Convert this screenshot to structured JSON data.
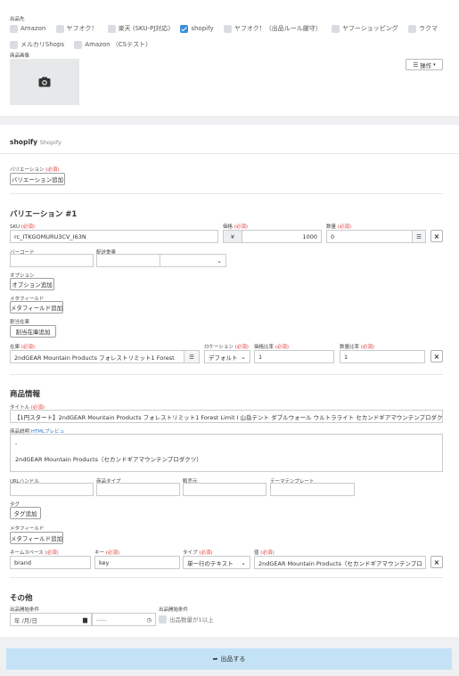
{
  "stores": {
    "label": "出品先",
    "items": [
      {
        "label": "Amazon",
        "checked": false
      },
      {
        "label": "ヤフオク！",
        "checked": false
      },
      {
        "label": "楽天 (SKU-PJ対応)",
        "checked": false
      },
      {
        "label": "shopify",
        "checked": true
      },
      {
        "label": "ヤフオク！（出品ルール厳守）",
        "checked": false
      },
      {
        "label": "ヤフーショッピング",
        "checked": false
      },
      {
        "label": "ラクマ",
        "checked": false
      },
      {
        "label": "メルカリShops",
        "checked": false
      },
      {
        "label": "Amazon （CSテスト）",
        "checked": false
      }
    ]
  },
  "product_image": {
    "label": "商品画像",
    "operations_label": "操作"
  },
  "shopify_header": {
    "title": "shopify",
    "subtitle": "Shopify"
  },
  "variation": {
    "label": "バリエーション",
    "required": "(必須)",
    "add_button": "バリエーション追加",
    "heading": "バリエーション #1",
    "sku_label": "SKU",
    "sku_value": "rc_ITKGOMURU3CV_I63N",
    "price_label": "価格",
    "price_prefix": "¥",
    "price_value": "1000",
    "stock_label": "数量",
    "stock_value": "0",
    "barcode_label": "バーコード",
    "weight_label": "配送重量",
    "option_label": "オプション",
    "option_add": "オプション追加",
    "metafield_label": "メタフィールド",
    "metafield_add": "メタフィールド追加",
    "allocation_label": "割当在庫",
    "allocation_add": "割当在庫追加",
    "inventory_label": "在庫",
    "inventory_value": "2ndGEAR Mountain Products フォレストリミット1 Forest",
    "location_label": "ロケーション",
    "location_value": "デフォルト",
    "ratio_label": "価格比率",
    "ratio_value": "1",
    "qty_ratio_label": "数量比率",
    "qty_ratio_value": "1"
  },
  "product_info": {
    "heading": "商品情報",
    "title_label": "タイトル",
    "title_value": "【1円スタート】2ndGEAR Mountain Products フォレストリミット1 Forest Limit I 山岳テント ダブルウォール ウルトラライト セカンドギアマウンテンプロダクツ Grey / 2",
    "desc_label": "商品説明",
    "desc_link": "HTMLプレビュ",
    "desc_line1": "-",
    "desc_line2": "2ndGEAR Mountain Products（セカンドギアマウンテンプロダクツ）",
    "url_label": "URLハンドル",
    "type_label": "商品タイプ",
    "vendor_label": "販売元",
    "theme_label": "テーマテンプレート",
    "tag_label": "タグ",
    "tag_add": "タグ追加",
    "meta_label": "メタフィールド",
    "meta_add": "メタフィールド追加",
    "ns_label": "ネームスペース",
    "ns_value": "brand",
    "key_label": "キー",
    "key_value": "key",
    "type2_label": "タイプ",
    "type2_value": "単一行のテキスト",
    "value_label": "値",
    "value_value": "2ndGEAR Mountain Products（セカンドギアマウンテンプロ"
  },
  "other": {
    "heading": "その他",
    "start_label": "出品開始条件",
    "date_placeholder": "年 /月/日",
    "time_placeholder": "--:--",
    "cond_label": "出品開始条件",
    "cond_check": "出品数量が1以上"
  },
  "submit": {
    "label": "出品する"
  }
}
